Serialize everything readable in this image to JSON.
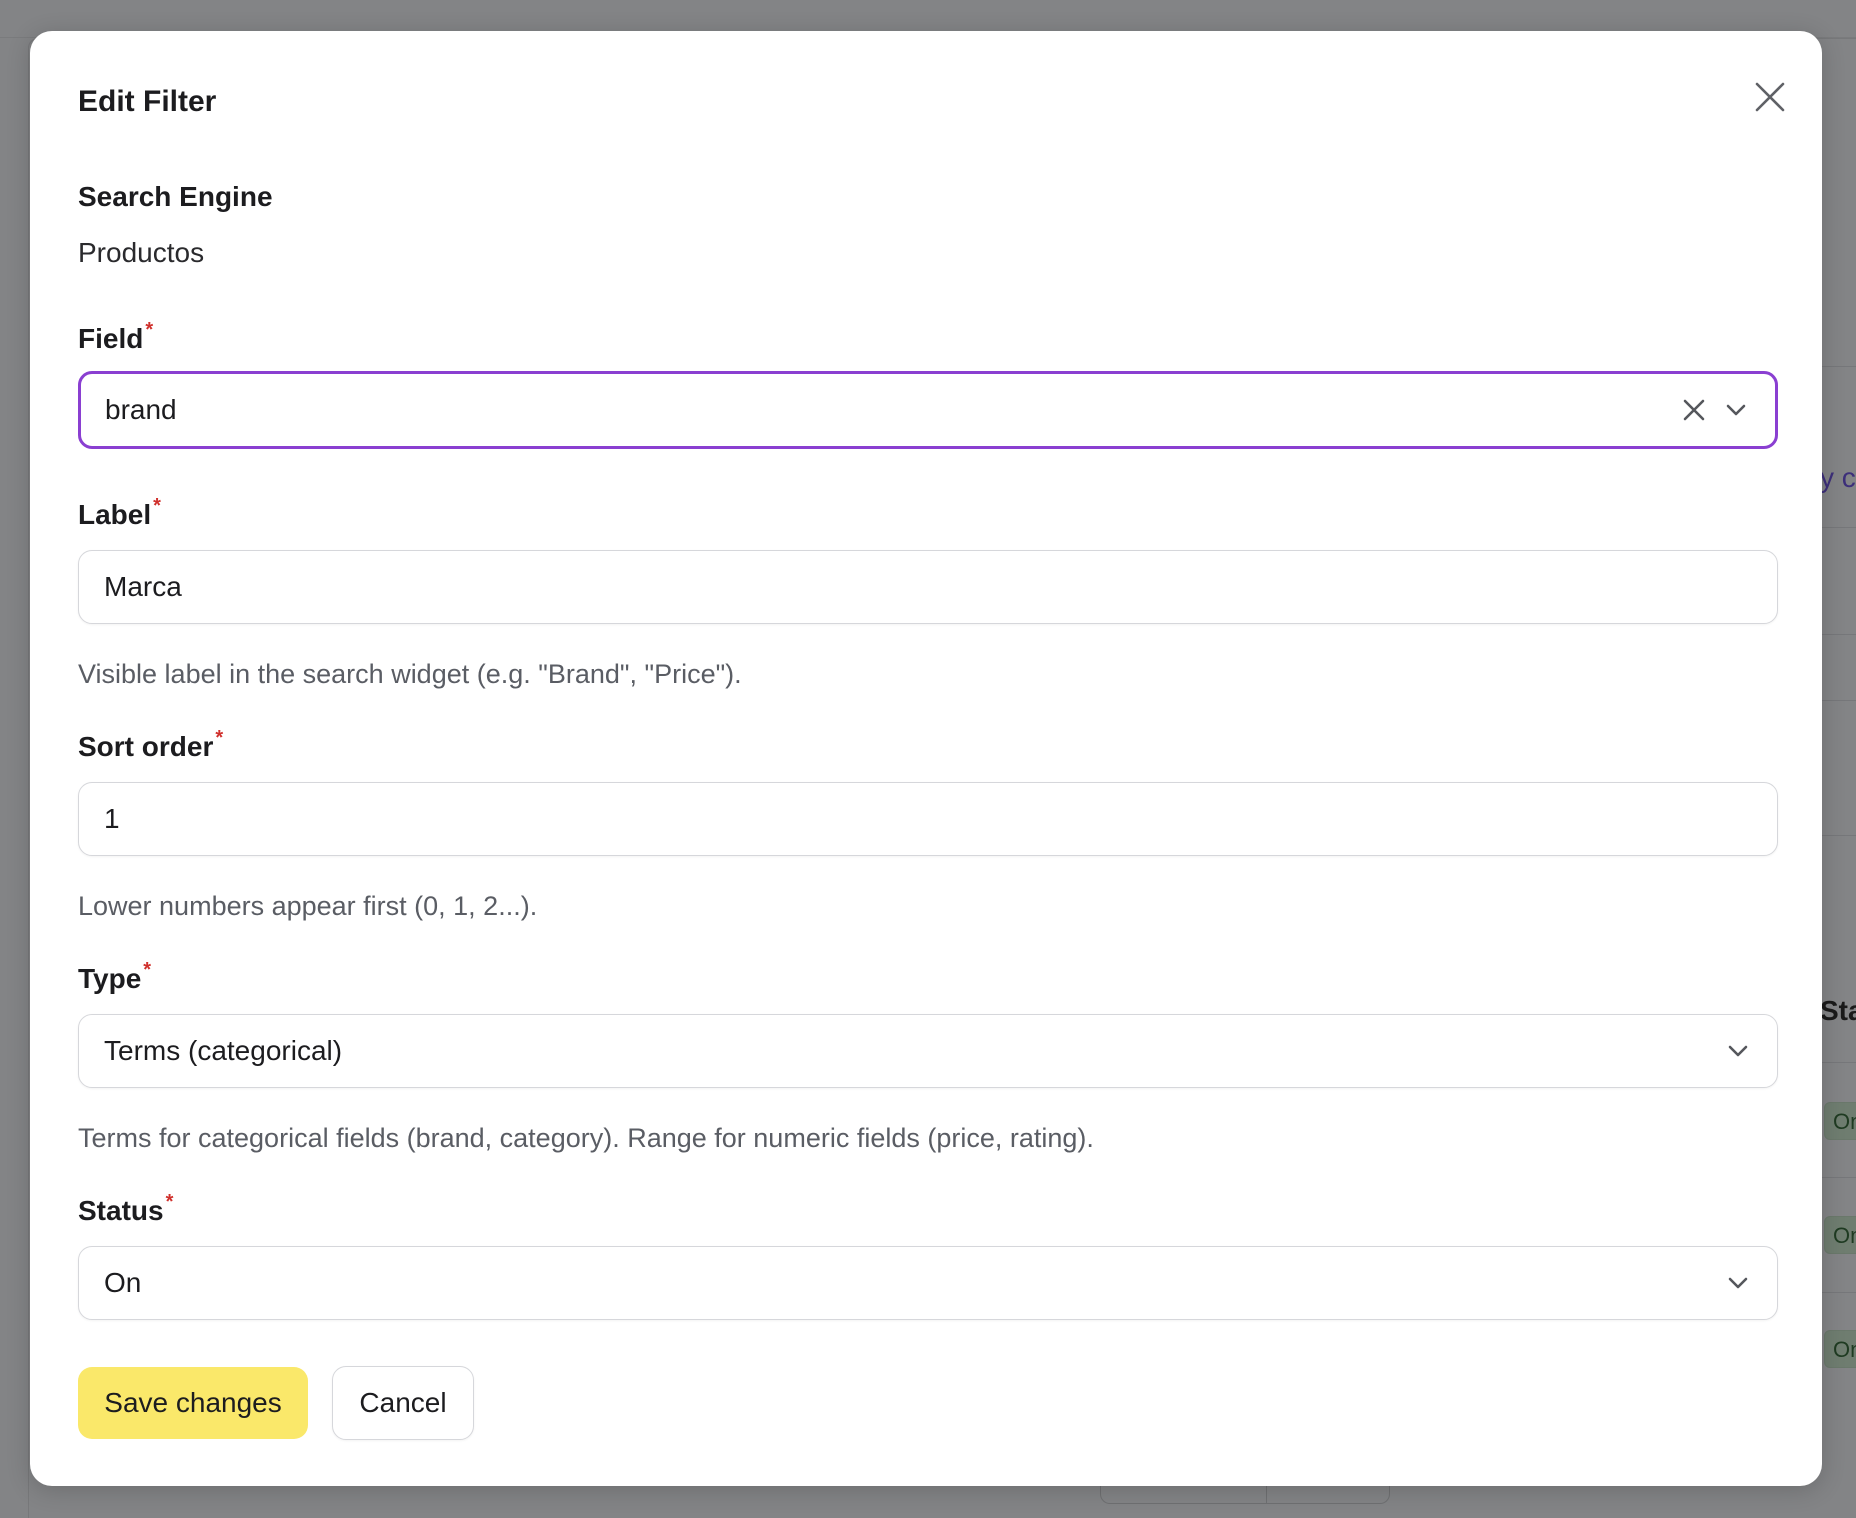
{
  "modal": {
    "title": "Edit Filter"
  },
  "search_engine": {
    "label": "Search Engine",
    "value": "Productos"
  },
  "field": {
    "label": "Field",
    "required_mark": "*",
    "value": "brand",
    "icons": [
      "close-icon",
      "chevron-down-icon"
    ]
  },
  "label_field": {
    "label": "Label",
    "required_mark": "*",
    "value": "Marca",
    "help": "Visible label in the search widget (e.g. \"Brand\", \"Price\")."
  },
  "sort_order": {
    "label": "Sort order",
    "required_mark": "*",
    "value": "1",
    "help": "Lower numbers appear first (0, 1, 2...)."
  },
  "type": {
    "label": "Type",
    "required_mark": "*",
    "value": "Terms (categorical)",
    "help": "Terms for categorical fields (brand, category). Range for numeric fields (price, rating)."
  },
  "status": {
    "label": "Status",
    "required_mark": "*",
    "value": "On"
  },
  "actions": {
    "save_label": "Save changes",
    "cancel_label": "Cancel"
  },
  "background": {
    "link_fragment": "y c",
    "column_header_fragment": "Sta",
    "badges": [
      "On",
      "On",
      "On"
    ]
  },
  "colors": {
    "focus_border": "#8a3fd1",
    "primary_button": "#fae86a",
    "required_mark": "#d0302c",
    "overlay": "#838486"
  }
}
